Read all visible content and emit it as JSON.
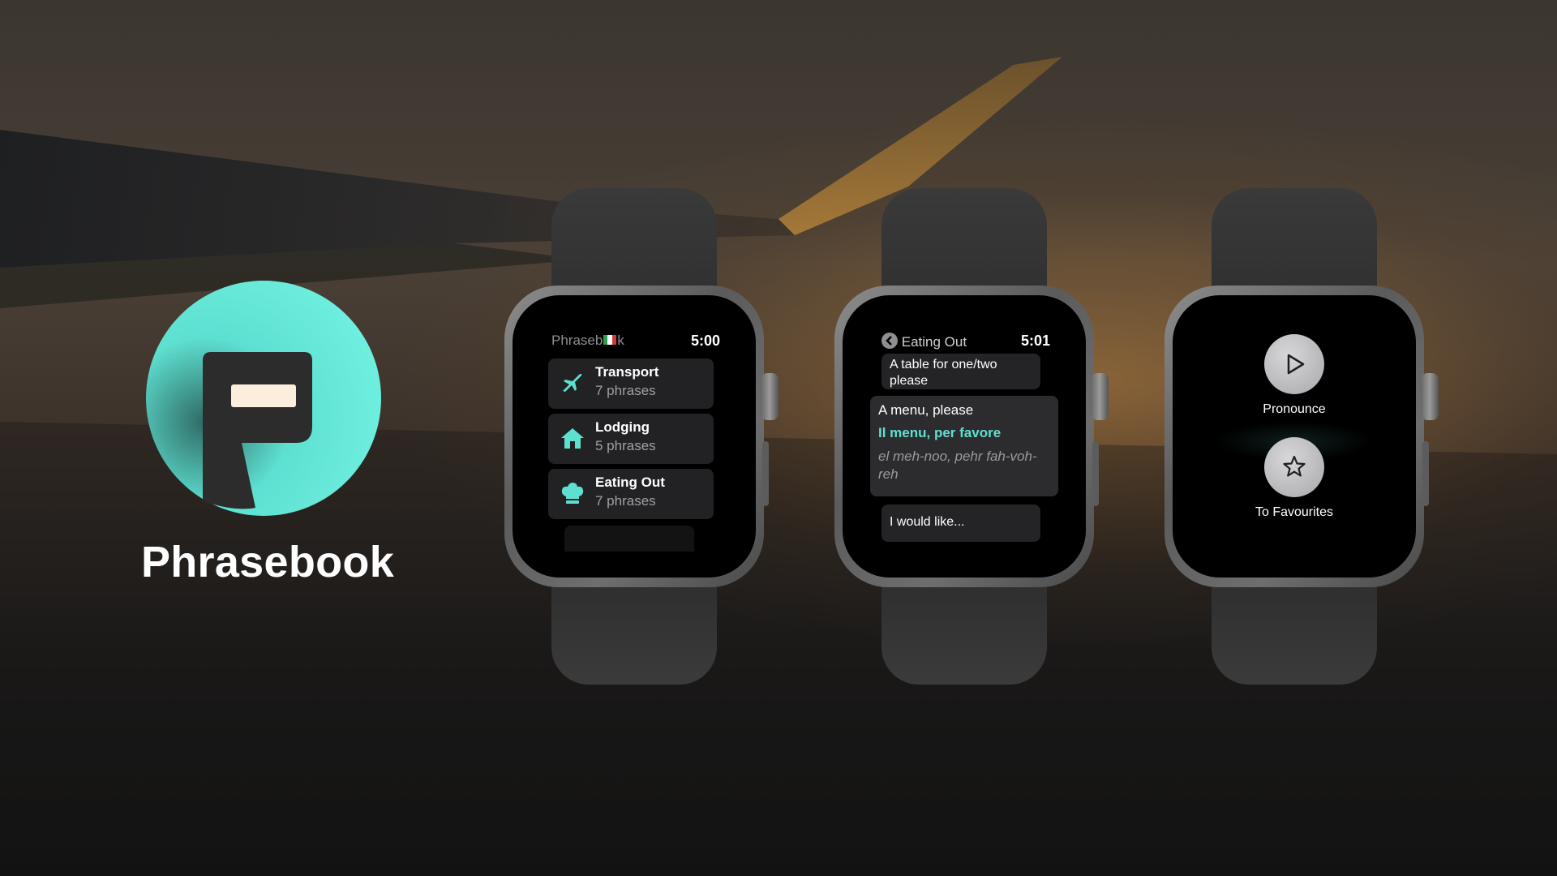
{
  "brand": {
    "name": "Phrasebook",
    "accent_color": "#5ee0d1"
  },
  "watch1": {
    "title": "Phraseb",
    "title_suffix": "k",
    "flag_icon": "italian-flag",
    "time": "5:00",
    "categories": [
      {
        "name": "Transport",
        "count": "7 phrases",
        "icon": "airplane-icon"
      },
      {
        "name": "Lodging",
        "count": "5 phrases",
        "icon": "house-icon"
      },
      {
        "name": "Eating Out",
        "count": "7 phrases",
        "icon": "chef-hat-icon"
      }
    ]
  },
  "watch2": {
    "back_title": "Eating Out",
    "time": "5:01",
    "phrases": {
      "previous": "A table for one/two please",
      "current_english": "A menu, please",
      "current_italian": "Il menu, per favore",
      "current_pronunciation": "el meh-noo, pehr fah-voh-reh",
      "next": "I would like..."
    }
  },
  "watch3": {
    "actions": [
      {
        "label": "Pronounce",
        "icon": "play-icon"
      },
      {
        "label": "To Favourites",
        "icon": "star-icon"
      }
    ]
  }
}
